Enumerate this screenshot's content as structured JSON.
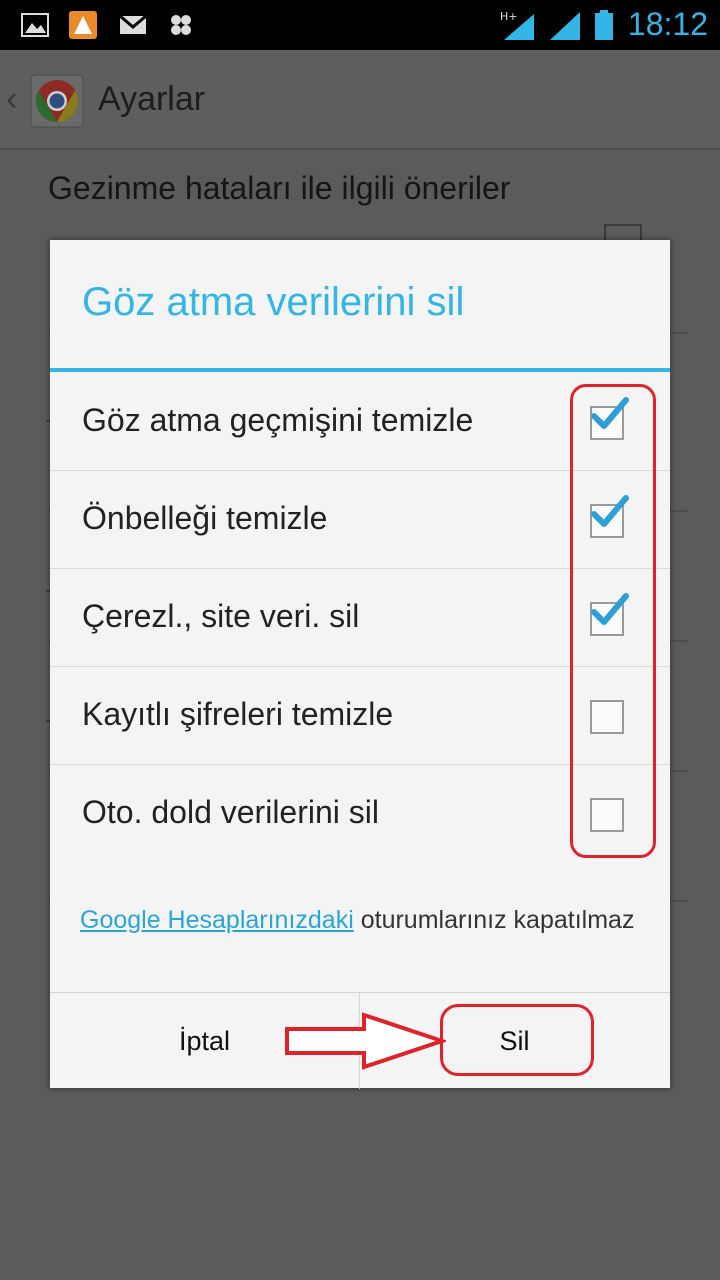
{
  "status_bar": {
    "time": "18:12",
    "icons": [
      "gallery-icon",
      "app-icon",
      "gmail-icon",
      "bug-icon",
      "signal-hplus-icon",
      "signal-2-icon",
      "battery-icon"
    ]
  },
  "action_bar": {
    "title": "Ayarlar"
  },
  "background": {
    "setting_title": "Gezinme hataları ile ilgili öneriler"
  },
  "dialog": {
    "title": "Göz atma verilerini sil",
    "options": [
      {
        "label": "Göz atma geçmişini temizle",
        "checked": true
      },
      {
        "label": "Önbelleği temizle",
        "checked": true
      },
      {
        "label": "Çerezl., site veri. sil",
        "checked": true
      },
      {
        "label": "Kayıtlı şifreleri temizle",
        "checked": false
      },
      {
        "label": "Oto. dold verilerini sil",
        "checked": false
      }
    ],
    "footer_link": "Google Hesaplarınızdaki",
    "footer_text": " oturumlarınız kapatılmaz",
    "cancel_label": "İptal",
    "confirm_label": "Sil"
  },
  "colors": {
    "accent": "#33b5e5",
    "annotation": "#e0232b"
  }
}
